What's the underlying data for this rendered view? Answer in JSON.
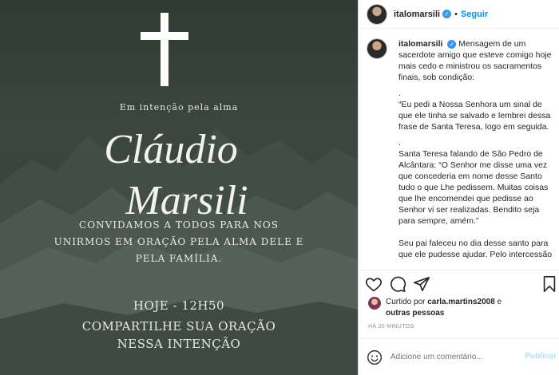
{
  "post_image": {
    "intent_line": "Em intenção pela alma",
    "name_line1": "Cláudio",
    "name_line2": "Marsili",
    "invite_line1": "Convidamos a todos para nos",
    "invite_line2": "unirmos em oração pela alma dele e",
    "invite_line3": "pela família.",
    "time_line": "Hoje - 12h50",
    "share_line1": "COMPARTILHE SUA ORAÇÃO",
    "share_line2": "NESSA INTENÇÃO"
  },
  "header": {
    "username": "italomarsili",
    "separator": "•",
    "follow_label": "Seguir"
  },
  "caption": {
    "username": "italomarsili",
    "lines": [
      "Mensagem de um sacerdote amigo que esteve comigo hoje mais cedo e ministrou os sacramentos finais, sob condição:",
      ".",
      "“Eu pedi a Nossa Senhora um sinal de que ele tinha se salvado e lembrei dessa frase de Santa Teresa, logo em seguida.",
      ".",
      "Santa Teresa falando de São Pedro de Alcântara: “O Senhor me disse uma vez que concederia em nome desse Santo tudo o que Lhe pedissem. Muitas coisas que lhe encomendei que pedisse ao Senhor vi ser realizadas. Bendito seja para sempre, amém.”",
      "Seu pai faleceu no dia desse santo para que ele pudesse ajudar. Pelo intercessão"
    ]
  },
  "likes": {
    "prefix": "Curtido por",
    "user": "carla.martins2008",
    "suffix": "e",
    "others": "outras pessoas"
  },
  "timestamp": "HÁ 20 MINUTOS",
  "comment": {
    "placeholder": "Adicione um comentário...",
    "publish_label": "Publicar"
  },
  "icons": {
    "verified": "verified-badge-icon",
    "like": "heart-icon",
    "comment": "comment-icon",
    "share": "share-icon",
    "save": "bookmark-icon",
    "emoji": "emoji-icon"
  },
  "colors": {
    "accent": "#0095f6",
    "verified": "#3897f0",
    "publish_disabled": "#b2dffc",
    "image_bg": "#343f39"
  }
}
